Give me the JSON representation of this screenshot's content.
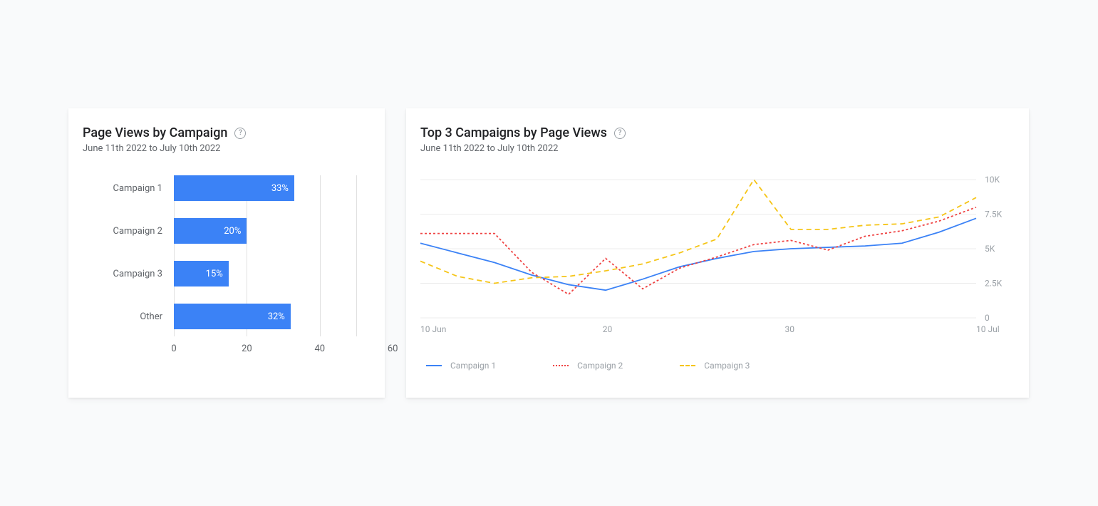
{
  "left": {
    "title": "Page Views by Campaign",
    "subtitle": "June 11th 2022 to July 10th 2022"
  },
  "right": {
    "title": "Top 3 Campaigns by Page Views",
    "subtitle": "June 11th 2022 to July 10th 2022"
  },
  "chart_data": [
    {
      "type": "bar",
      "orientation": "horizontal",
      "title": "Page Views by Campaign",
      "xlabel": "",
      "ylabel": "",
      "xlim": [
        0,
        60
      ],
      "xticks": [
        0,
        20,
        40,
        60
      ],
      "categories": [
        "Campaign 1",
        "Campaign 2",
        "Campaign 3",
        "Other"
      ],
      "values": [
        33,
        20,
        15,
        32
      ],
      "value_labels": [
        "33%",
        "20%",
        "15%",
        "32%"
      ],
      "bar_color": "#3b82f6"
    },
    {
      "type": "line",
      "title": "Top 3 Campaigns by Page Views",
      "xlabel": "",
      "ylabel": "",
      "ylim": [
        0,
        10000
      ],
      "yticks": [
        0,
        2500,
        5000,
        7500,
        10000
      ],
      "ytick_labels": [
        "0",
        "2.5K",
        "5K",
        "7.5K",
        "10K"
      ],
      "x": [
        10,
        12,
        14,
        16,
        18,
        20,
        22,
        24,
        26,
        28,
        30,
        2,
        4,
        6,
        8,
        10.5
      ],
      "xtick_labels": [
        "10 Jun",
        "20",
        "30",
        "10 Jul"
      ],
      "xtick_positions": [
        10,
        20,
        30,
        40.5
      ],
      "series": [
        {
          "name": "Campaign 1",
          "color": "#3b82f6",
          "dash": "solid",
          "values": [
            5400,
            4700,
            4000,
            3100,
            2400,
            2000,
            2800,
            3700,
            4300,
            4800,
            5000,
            5100,
            5200,
            5400,
            6200,
            7200
          ]
        },
        {
          "name": "Campaign 2",
          "color": "#ef4444",
          "dash": "dotted",
          "values": [
            6100,
            6100,
            6100,
            3300,
            1700,
            4300,
            2100,
            3600,
            4400,
            5300,
            5600,
            4900,
            5900,
            6300,
            7000,
            8000
          ]
        },
        {
          "name": "Campaign 3",
          "color": "#f5c518",
          "dash": "dashed",
          "values": [
            4100,
            3000,
            2500,
            2900,
            3000,
            3400,
            3900,
            4700,
            5700,
            10000,
            6400,
            6400,
            6700,
            6800,
            7300,
            8700
          ]
        }
      ],
      "legend": [
        "Campaign 1",
        "Campaign 2",
        "Campaign 3"
      ]
    }
  ]
}
